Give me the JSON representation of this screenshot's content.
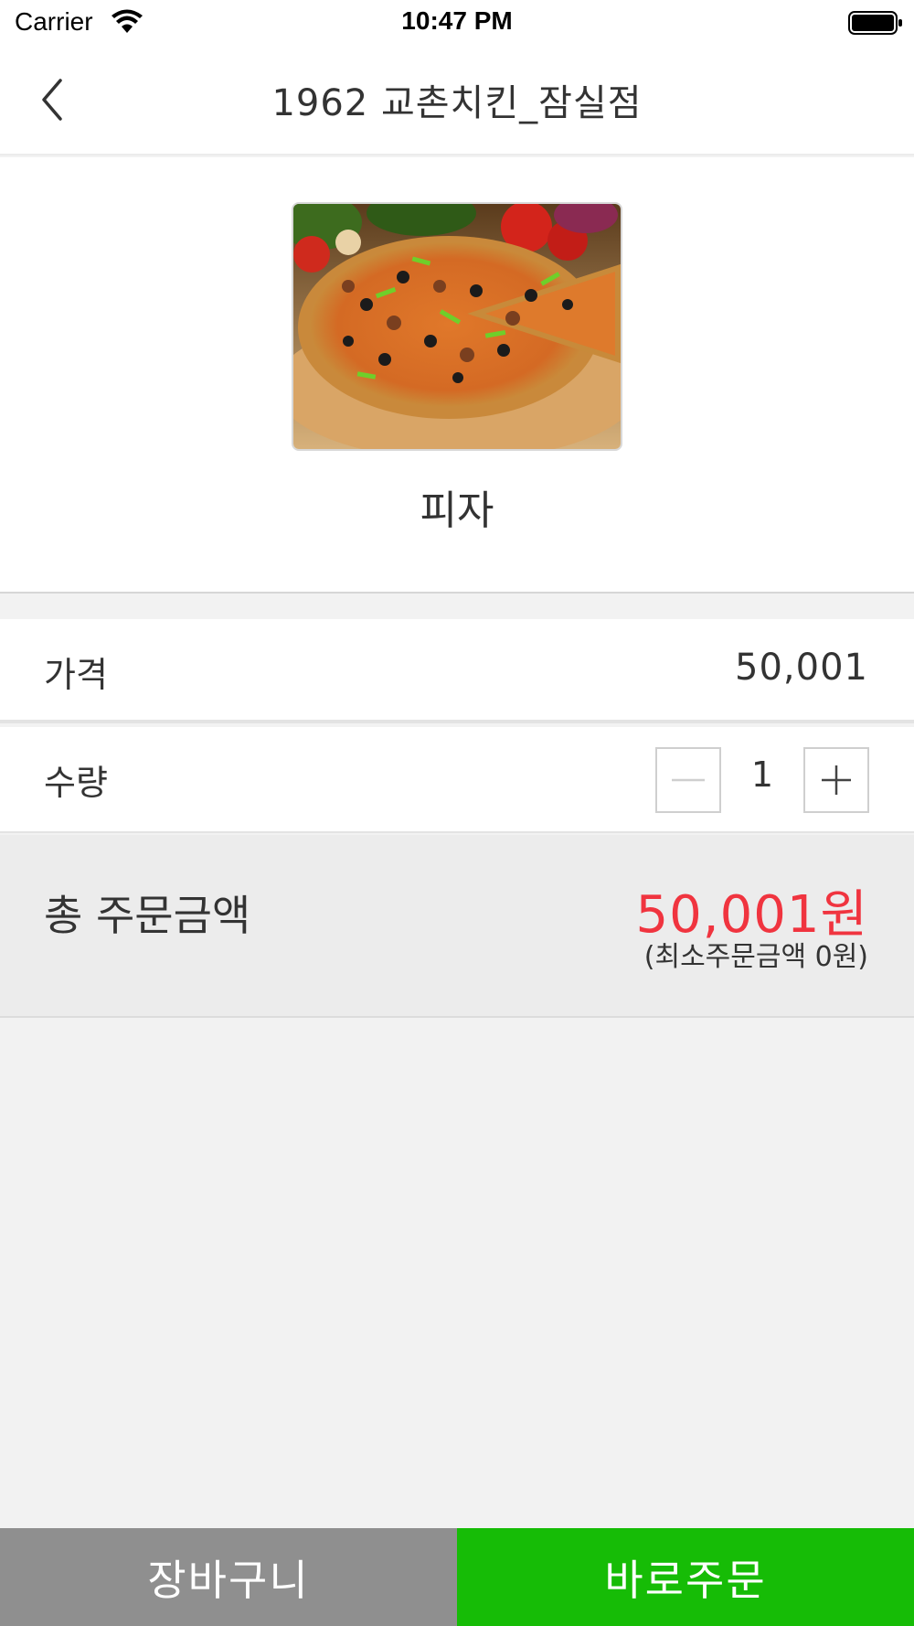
{
  "status_bar": {
    "carrier": "Carrier",
    "time": "10:47 PM",
    "icons": [
      "wifi-icon",
      "battery-icon"
    ]
  },
  "nav": {
    "title": "1962 교촌치킨_잠실점",
    "back_icon": "chevron-left-icon"
  },
  "product": {
    "name": "피자",
    "image": "pizza-photo"
  },
  "price": {
    "label": "가격",
    "value": "50,001"
  },
  "quantity": {
    "label": "수량",
    "value": "1",
    "minus_icon": "minus-icon",
    "plus_icon": "plus-icon"
  },
  "total": {
    "label": "총 주문금액",
    "amount": "50,001원",
    "min_order": "(최소주문금액 0원)"
  },
  "actions": {
    "cart_label": "장바구니",
    "order_label": "바로주문"
  },
  "colors": {
    "total_amount": "#f0343f",
    "cart_button": "#8f8f8f",
    "order_button": "#16bc06",
    "background": "#f2f2f2"
  }
}
